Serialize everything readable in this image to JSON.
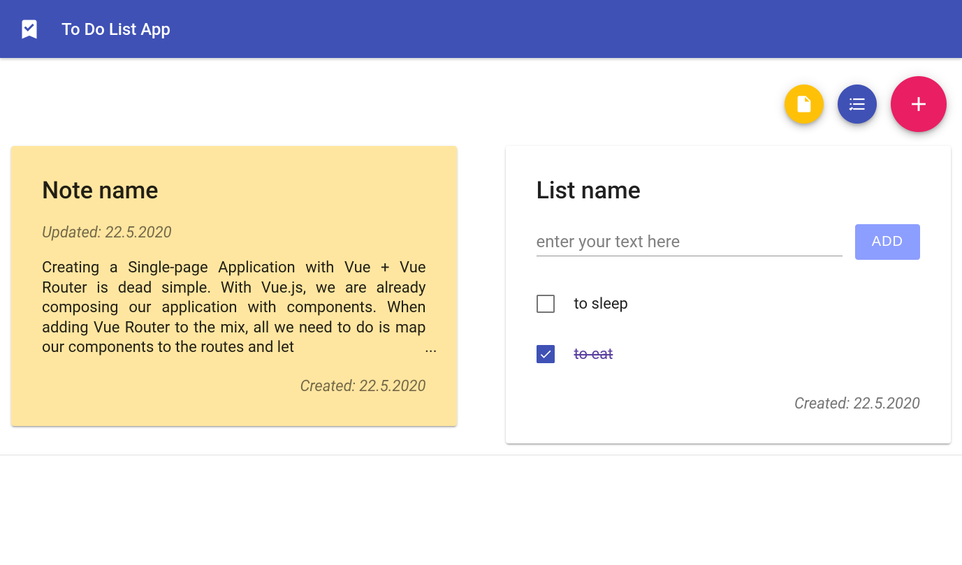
{
  "header": {
    "title": "To Do List App"
  },
  "note_card": {
    "title": "Note name",
    "updated_label": "Updated: 22.5.2020",
    "body": "Creating a Single-page Application with Vue + Vue Router is dead simple. With Vue.js, we are already composing our application with components. When adding Vue Router to the mix, all we need to do is map our components to the routes and let",
    "ellipsis": "...",
    "created_label": "Created: 22.5.2020"
  },
  "list_card": {
    "title": "List name",
    "input_placeholder": "enter your text here",
    "add_label": "ADD",
    "items": [
      {
        "text": "to sleep",
        "done": false
      },
      {
        "text": "to eat",
        "done": true
      }
    ],
    "created_label": "Created: 22.5.2020"
  }
}
